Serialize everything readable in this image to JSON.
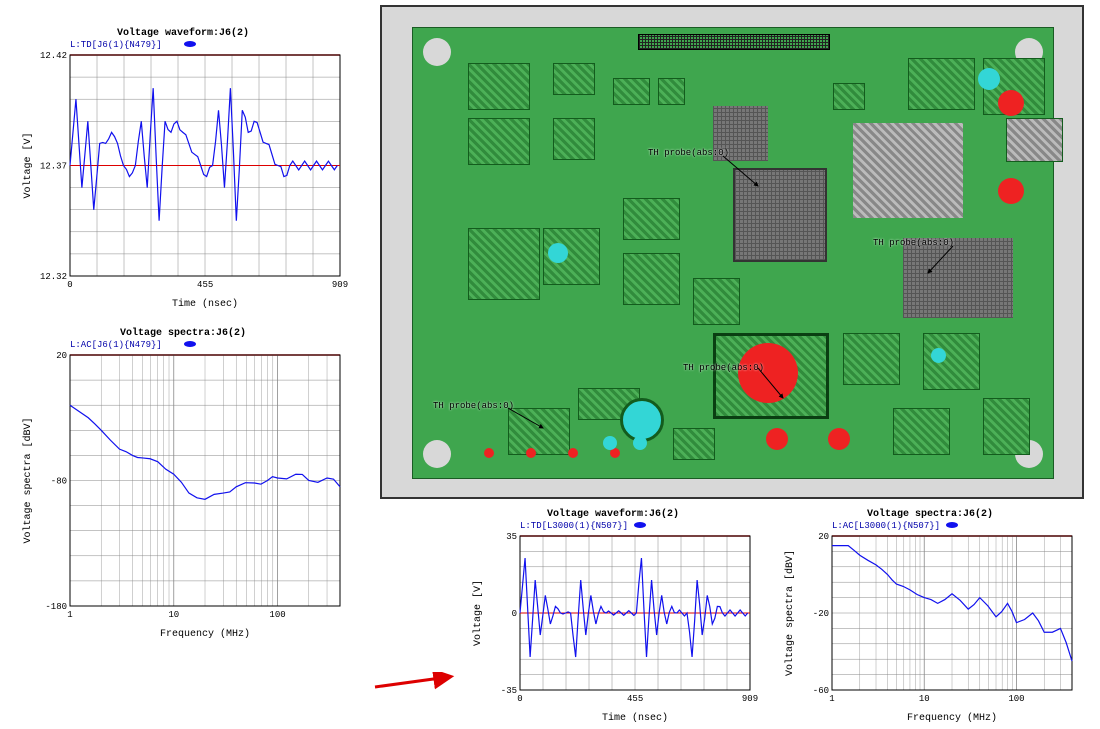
{
  "pcb": {
    "probe_labels": [
      "TH probe(abs:0)",
      "TH probe(abs:0)",
      "TH probe(abs:0)",
      "TH probe(abs:0)"
    ]
  },
  "chart_data": [
    {
      "id": "topleft",
      "type": "line",
      "title": "Voltage waveform:J6(2)",
      "legend": "L:TD[J6(1){N479}]",
      "xlabel": "Time (nsec)",
      "ylabel": "Voltage [V]",
      "xlim": [
        0,
        909
      ],
      "ylim": [
        12.32,
        12.42
      ],
      "xticks": [
        0,
        455,
        909
      ],
      "yticks": [
        12.32,
        12.37,
        12.42
      ],
      "baseline": 12.37,
      "x": [
        0,
        20,
        40,
        60,
        80,
        100,
        120,
        140,
        160,
        180,
        200,
        220,
        240,
        260,
        280,
        300,
        320,
        340,
        360,
        380,
        400,
        420,
        440,
        460,
        480,
        500,
        520,
        540,
        560,
        580,
        600,
        620,
        640,
        660,
        680,
        700,
        720,
        740,
        760,
        780,
        800,
        820,
        840,
        860,
        880,
        900
      ],
      "y": [
        12.37,
        12.4,
        12.36,
        12.39,
        12.35,
        12.38,
        12.38,
        12.385,
        12.38,
        12.37,
        12.365,
        12.37,
        12.39,
        12.36,
        12.405,
        12.345,
        12.39,
        12.385,
        12.39,
        12.385,
        12.38,
        12.375,
        12.37,
        12.365,
        12.37,
        12.395,
        12.36,
        12.405,
        12.345,
        12.395,
        12.385,
        12.39,
        12.385,
        12.38,
        12.375,
        12.37,
        12.365,
        12.37,
        12.37,
        12.37,
        12.37,
        12.37,
        12.37,
        12.37,
        12.37,
        12.37
      ]
    },
    {
      "id": "bottomleft",
      "type": "line",
      "title": "Voltage spectra:J6(2)",
      "legend": "L:AC[J6(1){N479}]",
      "xlabel": "Frequency (MHz)",
      "ylabel": "Voltage spectra [dBV]",
      "xscale": "log",
      "xlim": [
        1,
        400
      ],
      "ylim": [
        -180,
        20
      ],
      "xticks": [
        1,
        10,
        100
      ],
      "yticks": [
        -180,
        -80,
        20
      ],
      "x": [
        1,
        1.5,
        2,
        3,
        4,
        5,
        7,
        10,
        14,
        20,
        30,
        40,
        60,
        80,
        100,
        150,
        200,
        300,
        400
      ],
      "y": [
        -20,
        -30,
        -40,
        -55,
        -60,
        -62,
        -65,
        -75,
        -90,
        -95,
        -90,
        -85,
        -82,
        -80,
        -78,
        -75,
        -80,
        -78,
        -85
      ]
    },
    {
      "id": "bottommid",
      "type": "line",
      "title": "Voltage waveform:J6(2)",
      "legend": "L:TD[L3000(1){N507}]",
      "xlabel": "Time (nsec)",
      "ylabel": "Voltage [V]",
      "xlim": [
        0,
        909
      ],
      "ylim": [
        -35,
        35
      ],
      "xticks": [
        0,
        455,
        909
      ],
      "yticks": [
        -35,
        0,
        35
      ],
      "baseline": 0,
      "x": [
        0,
        20,
        40,
        60,
        80,
        100,
        120,
        140,
        160,
        180,
        200,
        220,
        240,
        260,
        280,
        300,
        320,
        340,
        360,
        380,
        400,
        420,
        440,
        460,
        480,
        500,
        520,
        540,
        560,
        580,
        600,
        620,
        640,
        660,
        680,
        700,
        720,
        740,
        760,
        780,
        800,
        820,
        840,
        860,
        880,
        900
      ],
      "y": [
        0,
        25,
        -20,
        15,
        -10,
        8,
        -5,
        3,
        0,
        0,
        0,
        -20,
        15,
        -10,
        8,
        -5,
        3,
        0,
        0,
        0,
        0,
        0,
        0,
        0,
        25,
        -20,
        15,
        -10,
        8,
        -5,
        3,
        0,
        0,
        0,
        -20,
        15,
        -10,
        8,
        -5,
        3,
        0,
        0,
        0,
        0,
        0,
        0
      ]
    },
    {
      "id": "bottomright",
      "type": "line",
      "title": "Voltage spectra:J6(2)",
      "legend": "L:AC[L3000(1){N507}]",
      "xlabel": "Frequency (MHz)",
      "ylabel": "Voltage spectra [dBV]",
      "xscale": "log",
      "xlim": [
        1,
        400
      ],
      "ylim": [
        -60,
        20
      ],
      "xticks": [
        1,
        10,
        100
      ],
      "yticks": [
        -60,
        -20,
        20
      ],
      "x": [
        1,
        1.5,
        2,
        3,
        4,
        5,
        7,
        10,
        14,
        20,
        30,
        40,
        60,
        80,
        100,
        150,
        200,
        300,
        400
      ],
      "y": [
        15,
        15,
        10,
        5,
        0,
        -5,
        -8,
        -12,
        -15,
        -10,
        -18,
        -12,
        -22,
        -15,
        -25,
        -20,
        -30,
        -28,
        -45
      ]
    }
  ]
}
